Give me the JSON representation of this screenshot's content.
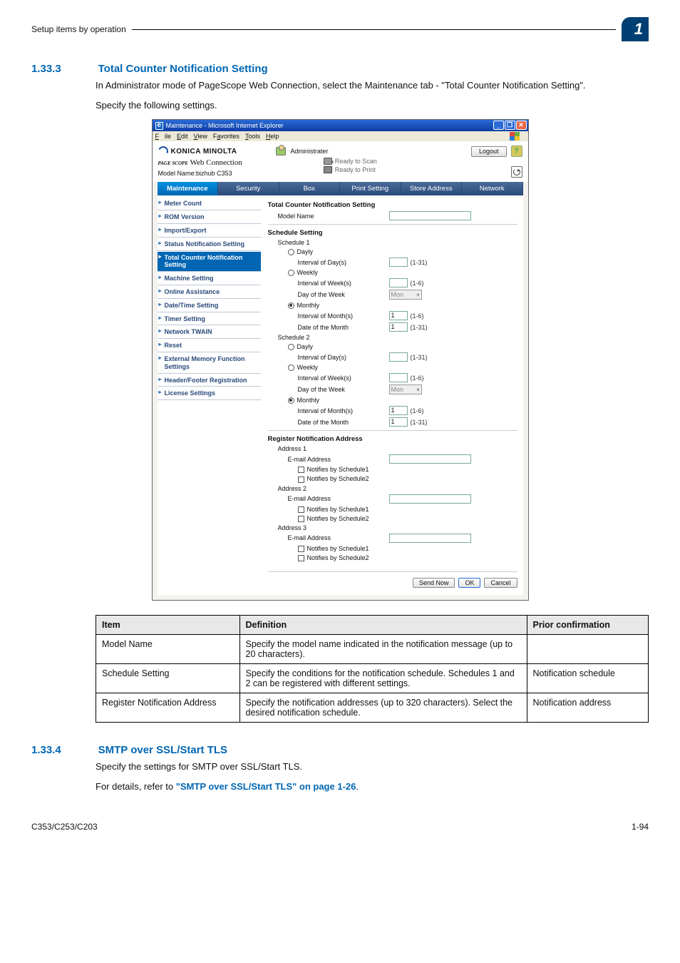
{
  "header": {
    "breadcrumb": "Setup items by operation",
    "chapter_badge": "1"
  },
  "section1": {
    "num": "1.33.3",
    "title": "Total Counter Notification Setting",
    "para1": "In Administrator mode of PageScope Web Connection, select the Maintenance tab - \"Total Counter Notification Setting\".",
    "para2": "Specify the following settings."
  },
  "ie": {
    "title": "Maintenance - Microsoft Internet Explorer",
    "menu": {
      "file": "File",
      "edit": "Edit",
      "view": "View",
      "favorites": "Favorites",
      "tools": "Tools",
      "help": "Help"
    },
    "brand": "KONICA MINOLTA",
    "admin_label": "Administrater",
    "logout": "Logout",
    "ps_brand_lead": "PAGE SCOPE",
    "ps_brand_tail": " Web Connection",
    "model_line": "Model Name:bizhub C353",
    "ready_scan": "Ready to Scan",
    "ready_print": "Ready to Print",
    "tabs": [
      "Maintenance",
      "Security",
      "Box",
      "Print Setting",
      "Store Address",
      "Network"
    ],
    "active_tab": 0,
    "sidenav": [
      "Meter Count",
      "ROM Version",
      "Import/Export",
      "Status Notification Setting",
      "Total Counter Notification Setting",
      "Machine Setting",
      "Online Assistance",
      "Date/Time Setting",
      "Timer Setting",
      "Network TWAIN",
      "Reset",
      "External Memory Function Settings",
      "Header/Footer Registration",
      "License Settings"
    ],
    "selected_nav": 4,
    "form": {
      "heading": "Total Counter Notification Setting",
      "model_name_label": "Model Name",
      "schedule_heading": "Schedule Setting",
      "schedule1": "Schedule 1",
      "schedule2": "Schedule 2",
      "dayly": "Dayly",
      "weekly": "Weekly",
      "monthly": "Monthly",
      "interval_day": "Interval of Day(s)",
      "interval_week": "Interval of Week(s)",
      "day_of_week": "Day of the Week",
      "interval_month": "Interval of Month(s)",
      "date_of_month": "Date of the Month",
      "hint_1_31": "(1-31)",
      "hint_1_6": "(1-6)",
      "dow_value": "Mon",
      "val_1": "1",
      "reg_heading": "Register Notification Address",
      "address": "Address",
      "email_label": "E-mail Address",
      "notif_s1": "Notifies by Schedule1",
      "notif_s2": "Notifies by Schedule2",
      "btn_send": "Send Now",
      "btn_ok": "OK",
      "btn_cancel": "Cancel"
    }
  },
  "table": {
    "col_item": "Item",
    "col_def": "Definition",
    "col_prior": "Prior confirmation",
    "rows": [
      {
        "item": "Model Name",
        "def": "Specify the model name indicated in the notification message (up to 20 characters).",
        "prior": ""
      },
      {
        "item": "Schedule Setting",
        "def": "Specify the conditions for the notification schedule. Schedules 1 and 2 can be registered with different settings.",
        "prior": "Notification schedule"
      },
      {
        "item": "Register Notification Address",
        "def": "Specify the notification addresses (up to 320 characters). Select the desired notification schedule.",
        "prior": "Notification address"
      }
    ]
  },
  "section2": {
    "num": "1.33.4",
    "title": "SMTP over SSL/Start TLS",
    "para1": "Specify the settings for SMTP over SSL/Start TLS.",
    "para2_pre": "For details, refer to ",
    "xref": "\"SMTP over SSL/Start TLS\" on page 1-26",
    "para2_post": "."
  },
  "footer": {
    "left": "C353/C253/C203",
    "right": "1-94"
  }
}
